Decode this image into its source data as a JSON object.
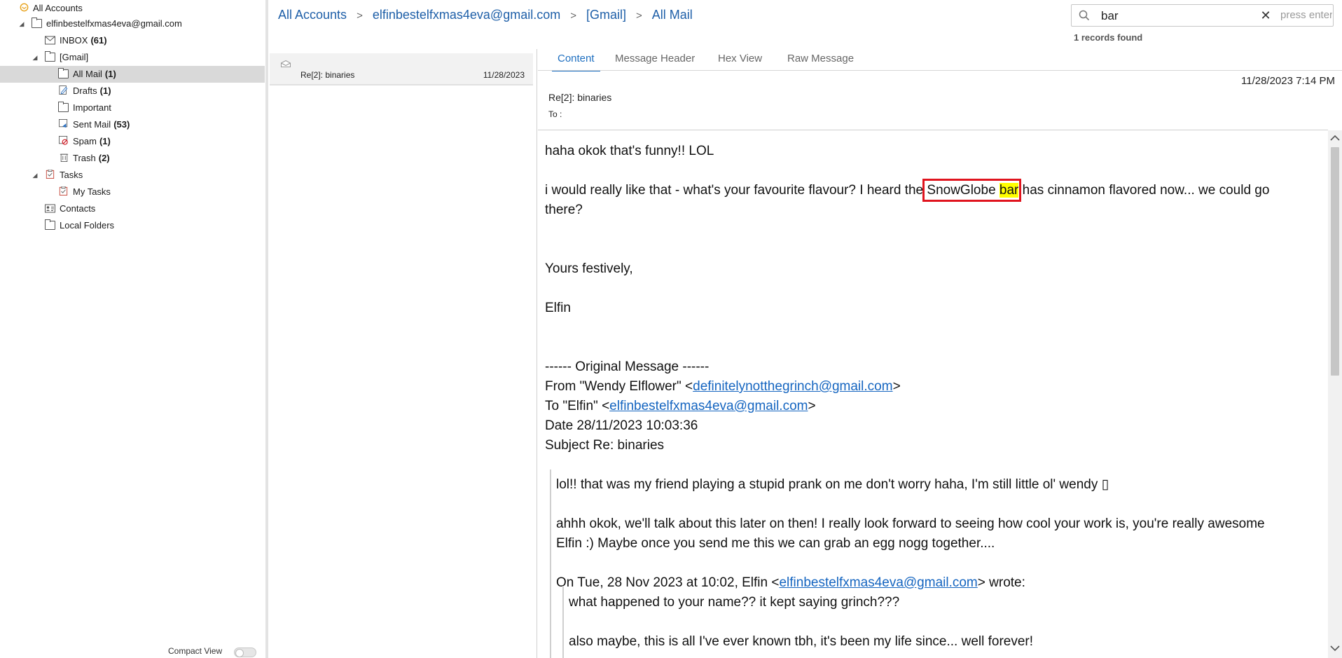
{
  "tree": {
    "items": [
      {
        "label": "All Accounts",
        "count": "",
        "arrow": "",
        "icon": "all-accounts-icon"
      },
      {
        "label": "elfinbestelfxmas4eva@gmail.com",
        "count": "",
        "arrow": "◢",
        "icon": "account-icon"
      },
      {
        "label": "INBOX",
        "count": "(61)",
        "arrow": "",
        "icon": "inbox-icon"
      },
      {
        "label": "[Gmail]",
        "count": "",
        "arrow": "◢",
        "icon": "folder-icon"
      },
      {
        "label": "All Mail",
        "count": "(1)",
        "arrow": "",
        "icon": "folder-icon"
      },
      {
        "label": "Drafts",
        "count": "(1)",
        "arrow": "",
        "icon": "drafts-icon"
      },
      {
        "label": "Important",
        "count": "",
        "arrow": "",
        "icon": "folder-icon"
      },
      {
        "label": "Sent Mail",
        "count": "(53)",
        "arrow": "",
        "icon": "sent-icon"
      },
      {
        "label": "Spam",
        "count": "(1)",
        "arrow": "",
        "icon": "spam-icon"
      },
      {
        "label": "Trash",
        "count": "(2)",
        "arrow": "",
        "icon": "trash-icon"
      },
      {
        "label": "Tasks",
        "count": "",
        "arrow": "◢",
        "icon": "tasks-icon"
      },
      {
        "label": "My Tasks",
        "count": "",
        "arrow": "",
        "icon": "tasks-icon"
      },
      {
        "label": "Contacts",
        "count": "",
        "arrow": "",
        "icon": "contacts-icon"
      },
      {
        "label": "Local Folders",
        "count": "",
        "arrow": "",
        "icon": "folder-icon"
      }
    ],
    "compact_view_label": "Compact View"
  },
  "breadcrumb": {
    "items": [
      "All Accounts",
      "elfinbestelfxmas4eva@gmail.com",
      "[Gmail]",
      "All Mail"
    ],
    "separator": ">"
  },
  "search": {
    "value": "bar",
    "hint": "press enter",
    "records_found": "1 records found"
  },
  "message_list": {
    "rows": [
      {
        "subject": "Re[2]: binaries",
        "date": "11/28/2023"
      }
    ]
  },
  "reading_pane": {
    "tabs": [
      "Content",
      "Message Header",
      "Hex View",
      "Raw Message"
    ],
    "active_tab": "Content",
    "datetime": "11/28/2023 7:14 PM",
    "subject": "Re[2]: binaries",
    "to_label": "To :",
    "body": {
      "line1": "haha okok that's funny!! LOL",
      "line2_pre": "i would really like that - what's your favourite flavour? I heard the ",
      "line2_snow": "SnowGlobe ",
      "line2_hl": "bar",
      "line2_post": " has cinnamon flavored now... we could go",
      "line3": "there?",
      "signoff": "Yours festively,",
      "signature": "Elfin",
      "orig_header": "------ Original Message ------",
      "from_pre": "From \"Wendy Elflower\" <",
      "from_email": "definitelynotthegrinch@gmail.com",
      "to_pre": "To \"Elfin\" <",
      "to_email": "elfinbestelfxmas4eva@gmail.com",
      "close_angle": ">",
      "date_line": "Date 28/11/2023 10:03:36",
      "subject_line": "Subject Re: binaries",
      "q1_line1": "lol!! that was my friend playing a stupid prank on me don't worry haha, I'm still little ol' wendy ▯",
      "q1_line2": "ahhh okok, we'll talk about this later on then! I really look forward to seeing how cool your work is, you're really awesome",
      "q1_line3": "Elfin :) Maybe once you send me this we can grab an egg nogg together....",
      "q1_on_pre": "On Tue, 28 Nov 2023 at 10:02, Elfin <",
      "q1_on_email": "elfinbestelfxmas4eva@gmail.com",
      "q1_on_post": "> wrote:",
      "q2_line1": "what happened to your name?? it kept saying grinch???",
      "q2_line2": "also maybe, this is all I've ever known tbh, it's been my life since... well forever!"
    }
  },
  "colors": {
    "accent": "#1e6fc0",
    "link": "#1565c0",
    "highlight": "#ffff00",
    "annotation_box": "#e0141e"
  }
}
